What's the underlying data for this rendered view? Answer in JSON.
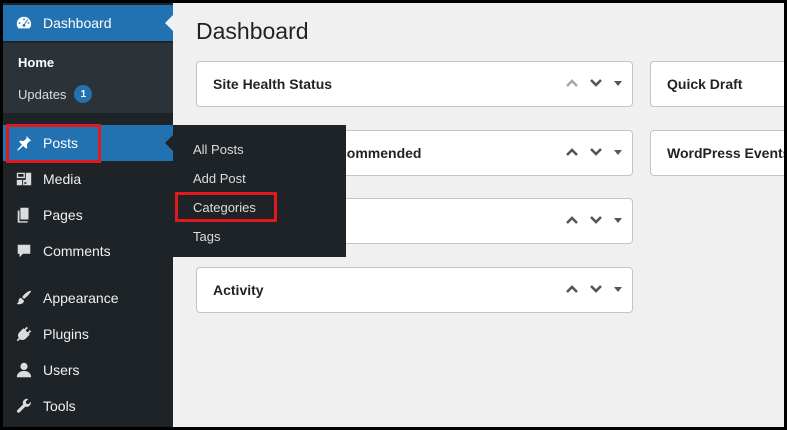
{
  "sidebar": {
    "dashboard_label": "Dashboard",
    "home_label": "Home",
    "updates_label": "Updates",
    "updates_count": "1",
    "items": [
      {
        "label": "Posts"
      },
      {
        "label": "Media"
      },
      {
        "label": "Pages"
      },
      {
        "label": "Comments"
      },
      {
        "label": "Appearance"
      },
      {
        "label": "Plugins"
      },
      {
        "label": "Users"
      },
      {
        "label": "Tools"
      }
    ]
  },
  "flyout": {
    "items": [
      "All Posts",
      "Add Post",
      "Categories",
      "Tags"
    ]
  },
  "main": {
    "title": "Dashboard",
    "boxes": [
      {
        "title": "Site Health Status"
      },
      {
        "title": "commended"
      },
      {
        "title": ""
      },
      {
        "title": "Activity"
      },
      {
        "title": "Quick Draft"
      },
      {
        "title": "WordPress Events"
      }
    ]
  },
  "colors": {
    "sidebar_bg": "#1d2327",
    "accent": "#2271b1",
    "highlight_red": "#e0191e"
  }
}
